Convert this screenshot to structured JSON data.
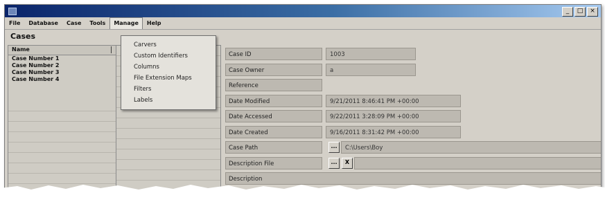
{
  "window": {
    "controls": [
      "_",
      "□",
      "×"
    ]
  },
  "menu": [
    "File",
    "Database",
    "Case",
    "Tools",
    "Manage",
    "Help"
  ],
  "cases_panel": {
    "title": "Cases",
    "column_header": "Name",
    "rows": [
      "Case Number 1",
      "Case Number 2",
      "Case Number 3",
      "Case Number 4"
    ]
  },
  "manage_menu": {
    "items": [
      "Carvers",
      "Custom Identifiers",
      "Columns",
      "File Extension Maps",
      "Filters",
      "Labels"
    ]
  },
  "properties": [
    {
      "label": "Case ID",
      "value": "1003"
    },
    {
      "label": "Case Owner",
      "value": "a"
    },
    {
      "label": "Reference",
      "value": ""
    },
    {
      "label": "Date Modified",
      "value": "9/21/2011 8:46:41 PM +00:00"
    },
    {
      "label": "Date Accessed",
      "value": "9/22/2011 3:28:09 PM +00:00"
    },
    {
      "label": "Date Created",
      "value": "9/16/2011 8:31:42 PM +00:00"
    },
    {
      "label": "Case Path",
      "value": "C:\\Users\\Boy"
    },
    {
      "label": "Description File",
      "value": ""
    },
    {
      "label": "Description",
      "value": ""
    }
  ],
  "buttons": {
    "browse": "...",
    "remove": "X"
  }
}
